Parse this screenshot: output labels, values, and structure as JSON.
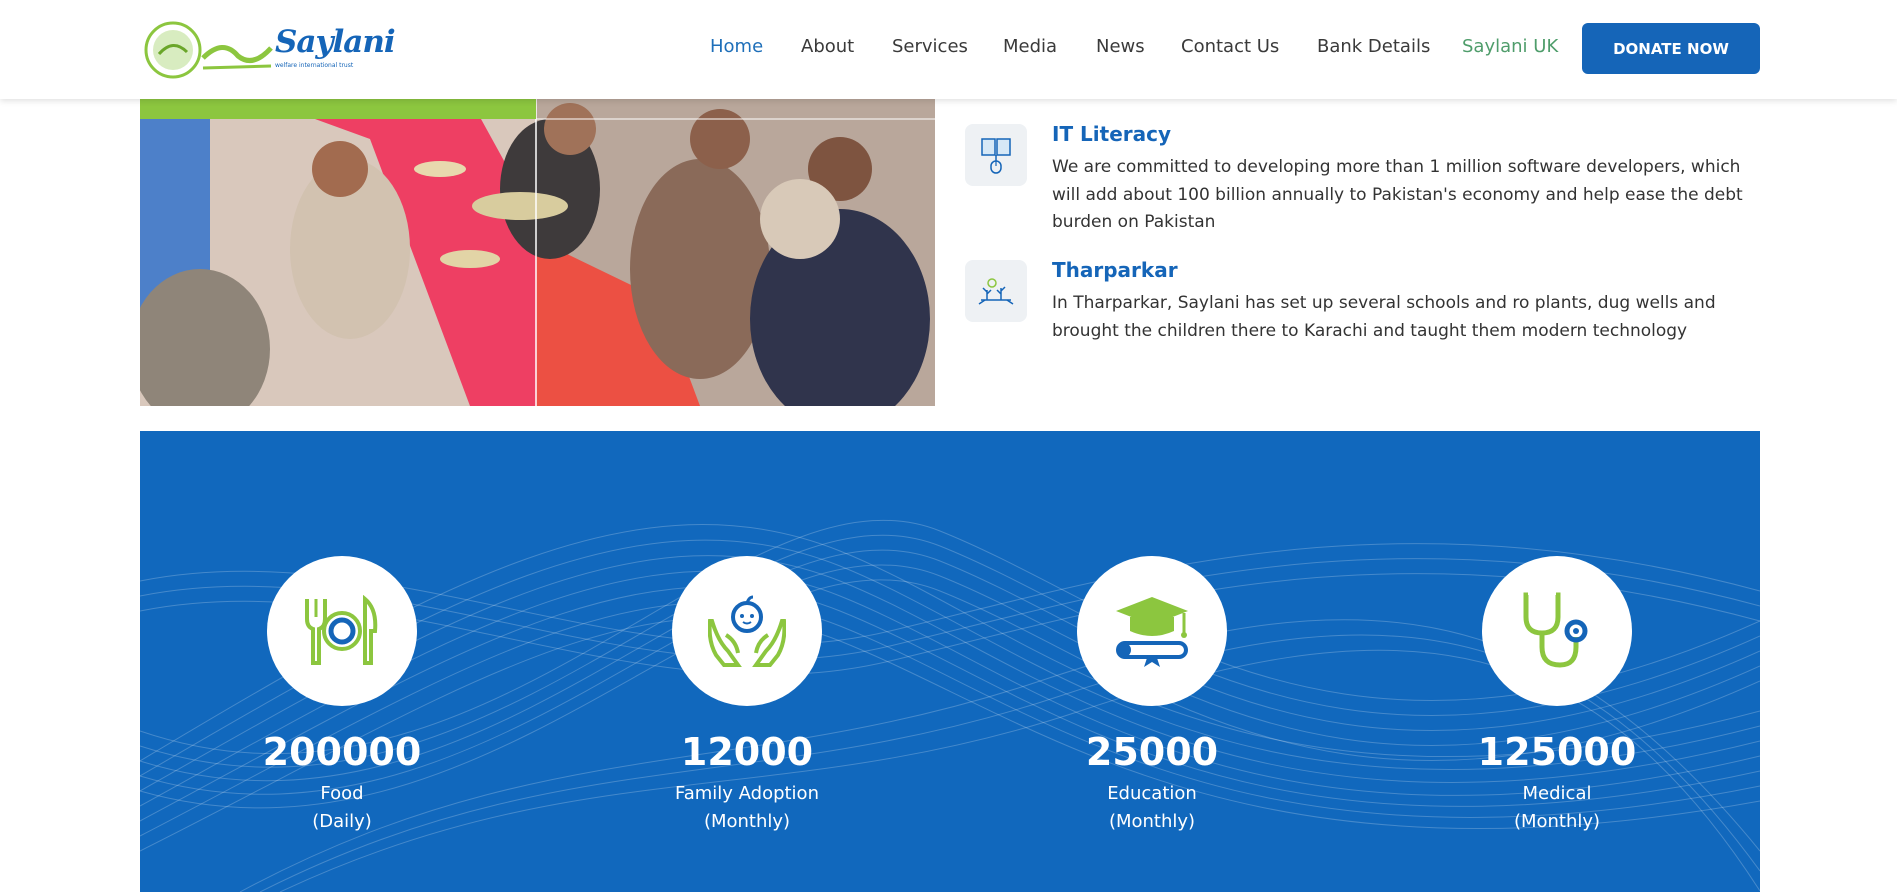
{
  "header": {
    "logo_text": "Saylani",
    "logo_subtext": "welfare international trust",
    "nav": [
      {
        "label": "Home"
      },
      {
        "label": "About"
      },
      {
        "label": "Services"
      },
      {
        "label": "Media"
      },
      {
        "label": "News"
      },
      {
        "label": "Contact Us"
      },
      {
        "label": "Bank Details"
      },
      {
        "label": "Saylani UK"
      }
    ],
    "donate_label": "DONATE NOW"
  },
  "features": [
    {
      "title": "IT Literacy",
      "description": "We are committed to developing more than 1 million software developers, which will add about 100 billion annually to Pakistan's economy and help ease the debt burden on Pakistan",
      "icon": "book-mouse-icon"
    },
    {
      "title": "Tharparkar",
      "description": "In Tharparkar, Saylani has set up several schools and ro plants, dug wells and brought the children there to Karachi and taught them modern technology",
      "icon": "desert-plant-icon"
    }
  ],
  "stats": [
    {
      "value": "200000",
      "label": "Food",
      "period": "(Daily)",
      "icon": "plate-fork-knife-icon"
    },
    {
      "value": "12000",
      "label": "Family Adoption",
      "period": "(Monthly)",
      "icon": "hands-baby-icon"
    },
    {
      "value": "25000",
      "label": "Education",
      "period": "(Monthly)",
      "icon": "graduation-cap-icon"
    },
    {
      "value": "125000",
      "label": "Medical",
      "period": "(Monthly)",
      "icon": "stethoscope-icon"
    }
  ],
  "colors": {
    "brand_blue": "#1565b8",
    "brand_green": "#8cc63f",
    "stats_bg": "#1168bd"
  }
}
